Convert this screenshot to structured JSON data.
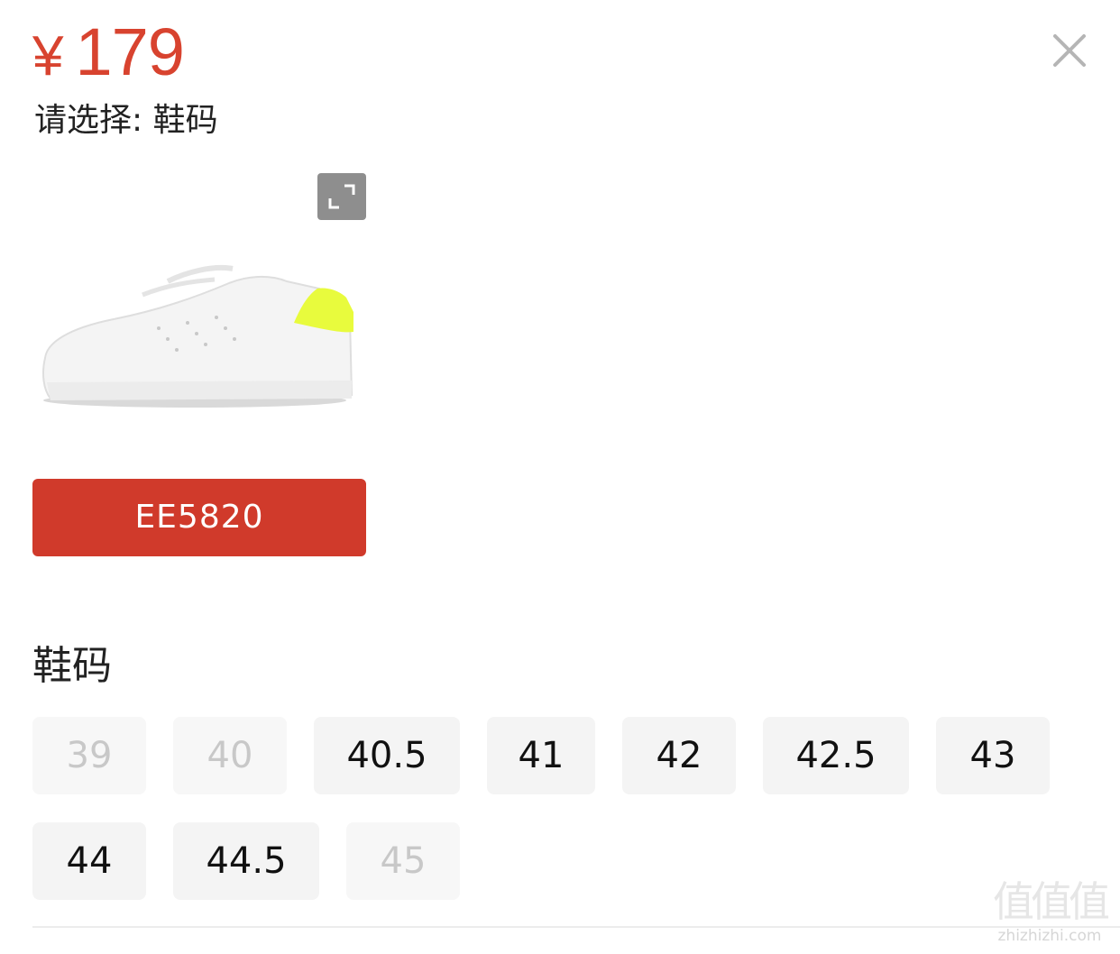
{
  "price": {
    "currency": "¥",
    "amount": "179"
  },
  "prompt": "请选择: 鞋码",
  "product": {
    "image": "white-sneaker-with-neon-yellow-heel-tab"
  },
  "variant": {
    "label": "EE5820",
    "color": "#d03a2b"
  },
  "size_section": {
    "title": "鞋码",
    "sizes": [
      {
        "label": "39",
        "available": false
      },
      {
        "label": "40",
        "available": false
      },
      {
        "label": "40.5",
        "available": true
      },
      {
        "label": "41",
        "available": true
      },
      {
        "label": "42",
        "available": true
      },
      {
        "label": "42.5",
        "available": true
      },
      {
        "label": "43",
        "available": true
      },
      {
        "label": "44",
        "available": true
      },
      {
        "label": "44.5",
        "available": true
      },
      {
        "label": "45",
        "available": false
      }
    ]
  },
  "icons": {
    "close": "close-icon",
    "expand": "expand-icon"
  },
  "watermark": {
    "glyphs": "值值值",
    "text": "zhizhizhi.com"
  },
  "colors": {
    "price": "#d8432f",
    "accent": "#d03a2b",
    "chip_bg": "#f4f4f4",
    "disabled_text": "#c8c8c8"
  }
}
